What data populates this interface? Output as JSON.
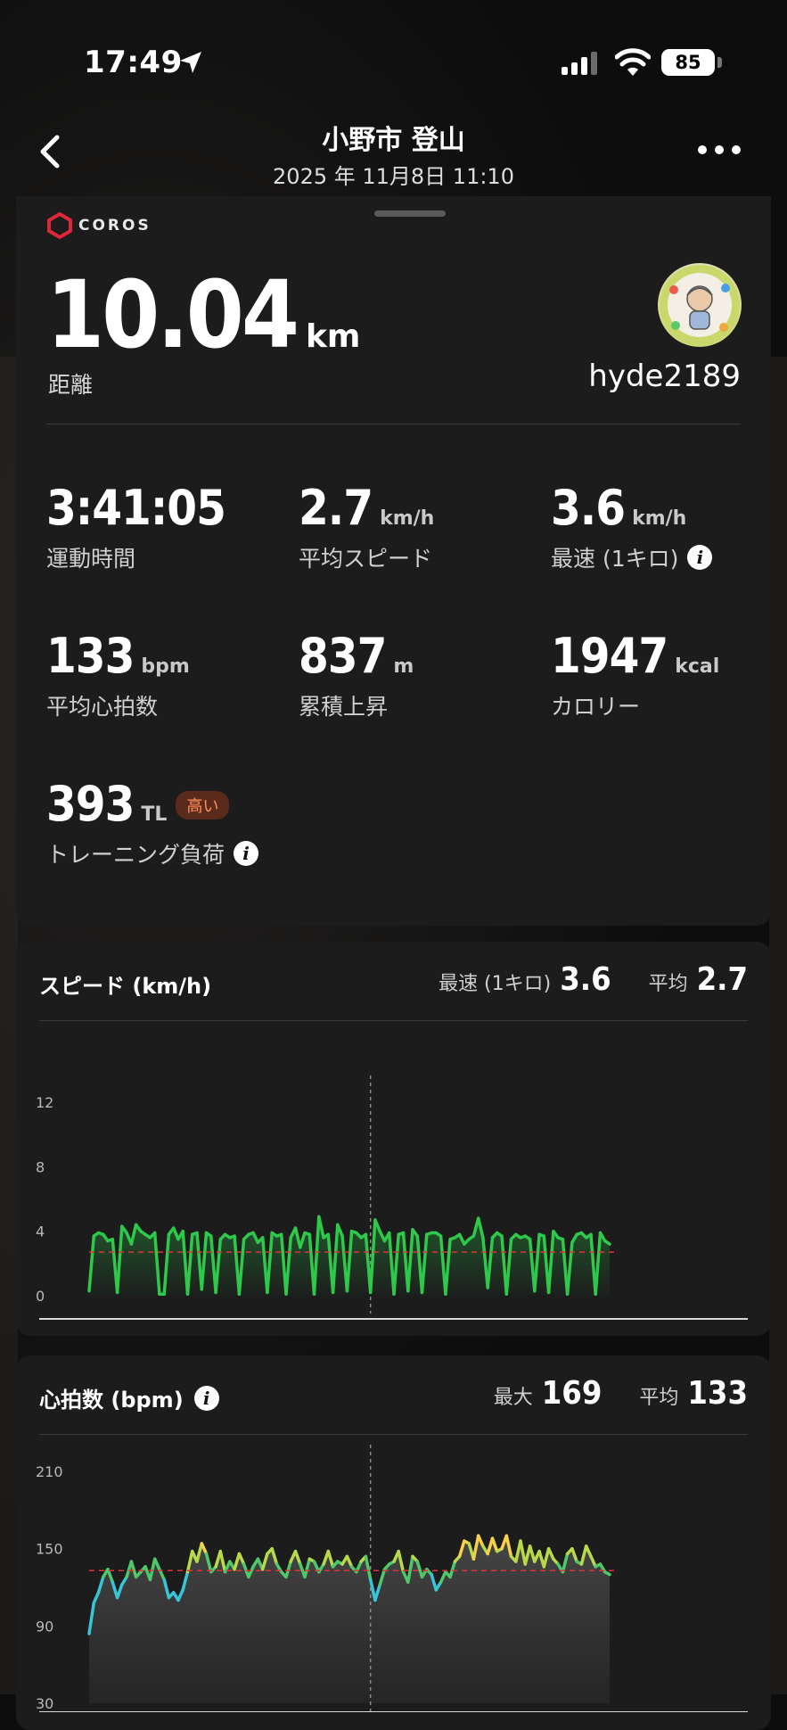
{
  "status_bar": {
    "time": "17:49",
    "battery": "85"
  },
  "header": {
    "title": "小野市 登山",
    "subtitle": "2025 年 11月8日 11:10"
  },
  "brand": "COROS",
  "summary": {
    "distance": {
      "value": "10.04",
      "unit": "km",
      "label": "距離"
    },
    "username": "hyde2189",
    "stats": [
      {
        "value": "3:41:05",
        "unit": "",
        "label": "運動時間",
        "info": false
      },
      {
        "value": "2.7",
        "unit": "km/h",
        "label": "平均スピード",
        "info": false
      },
      {
        "value": "3.6",
        "unit": "km/h",
        "label": "最速 (1キロ)",
        "info": true
      },
      {
        "value": "133",
        "unit": "bpm",
        "label": "平均心拍数",
        "info": false
      },
      {
        "value": "837",
        "unit": "m",
        "label": "累積上昇",
        "info": false
      },
      {
        "value": "1947",
        "unit": "kcal",
        "label": "カロリー",
        "info": false
      }
    ],
    "training_load": {
      "value": "393",
      "unit": "TL",
      "badge": "高い",
      "label": "トレーニング負荷"
    }
  },
  "speed_chart": {
    "title": "スピード (km/h)",
    "max_label": "最速 (1キロ)",
    "max_value": "3.6",
    "avg_label": "平均",
    "avg_value": "2.7"
  },
  "hr_chart": {
    "title": "心拍数 (bpm)",
    "max_label": "最大",
    "max_value": "169",
    "avg_label": "平均",
    "avg_value": "133"
  },
  "chart_data": [
    {
      "type": "line",
      "title": "スピード (km/h)",
      "xlabel": "",
      "ylabel": "",
      "x_ticks": [
        "0",
        "60",
        "120",
        "180",
        "222"
      ],
      "y_ticks": [
        "12",
        "8",
        "4",
        "0"
      ],
      "xlim": [
        0,
        222
      ],
      "ylim": [
        0,
        12
      ],
      "reference_line": 2.7,
      "color": "#2ec84a",
      "series": [
        {
          "x": [
            0,
            2,
            4,
            6,
            8,
            10,
            12,
            14,
            16,
            18,
            20,
            22,
            24,
            26,
            28,
            30,
            32,
            34,
            36,
            38,
            40,
            42,
            44,
            46,
            48,
            50,
            52,
            54,
            56,
            58,
            60,
            62,
            64,
            66,
            68,
            70,
            72,
            74,
            76,
            78,
            80,
            82,
            84,
            86,
            88,
            90,
            92,
            94,
            96,
            98,
            100,
            102,
            104,
            106,
            108,
            110,
            112,
            114,
            116,
            118,
            120,
            122,
            124,
            126,
            128,
            130,
            132,
            134,
            136,
            138,
            140,
            142,
            144,
            146,
            148,
            150,
            152,
            154,
            156,
            158,
            160,
            162,
            164,
            166,
            168,
            170,
            172,
            174,
            176,
            178,
            180,
            182,
            184,
            186,
            188,
            190,
            192,
            194,
            196,
            198,
            200,
            202,
            204,
            206,
            208,
            210,
            212,
            214,
            216,
            218,
            220,
            222
          ],
          "values": [
            0.3,
            3.7,
            3.9,
            3.8,
            3.4,
            3.5,
            0.2,
            4.3,
            3.9,
            3.2,
            4.4,
            4.0,
            3.8,
            3.6,
            3.9,
            0.1,
            0.1,
            3.8,
            4.2,
            3.5,
            4.0,
            0.1,
            3.8,
            3.9,
            0.4,
            3.9,
            3.7,
            0.2,
            3.5,
            3.8,
            3.6,
            3.7,
            0.1,
            3.5,
            3.8,
            3.9,
            3.3,
            3.6,
            0.2,
            3.9,
            3.7,
            3.8,
            0.1,
            3.6,
            4.2,
            3.0,
            3.9,
            3.8,
            0.1,
            4.9,
            3.6,
            3.8,
            0.2,
            4.4,
            3.7,
            0.3,
            4.0,
            3.9,
            3.6,
            3.8,
            0.2,
            4.7,
            4.0,
            3.4,
            3.9,
            0.1,
            3.8,
            3.9,
            0.3,
            4.1,
            3.7,
            0.2,
            3.8,
            3.9,
            3.9,
            3.7,
            0.1,
            3.5,
            3.6,
            3.8,
            3.2,
            3.5,
            3.7,
            4.8,
            3.6,
            0.5,
            3.6,
            3.9,
            3.7,
            0.1,
            3.5,
            3.8,
            3.6,
            3.7,
            3.5,
            0.3,
            3.8,
            3.7,
            0.2,
            4.0,
            3.6,
            3.5,
            0.1,
            3.3,
            3.8,
            3.9,
            3.6,
            3.8,
            0.1,
            3.9,
            3.4,
            3.2
          ]
        }
      ]
    },
    {
      "type": "line",
      "title": "心拍数 (bpm)",
      "xlabel": "",
      "ylabel": "",
      "y_ticks": [
        "210",
        "150",
        "90",
        "30"
      ],
      "xlim": [
        0,
        222
      ],
      "ylim": [
        30,
        210
      ],
      "reference_line": 133,
      "series": [
        {
          "x": [
            0,
            2,
            4,
            6,
            8,
            10,
            12,
            14,
            16,
            18,
            20,
            22,
            24,
            26,
            28,
            30,
            32,
            34,
            36,
            38,
            40,
            42,
            44,
            46,
            48,
            50,
            52,
            54,
            56,
            58,
            60,
            62,
            64,
            66,
            68,
            70,
            72,
            74,
            76,
            78,
            80,
            82,
            84,
            86,
            88,
            90,
            92,
            94,
            96,
            98,
            100,
            102,
            104,
            106,
            108,
            110,
            112,
            114,
            116,
            118,
            120,
            122,
            124,
            126,
            128,
            130,
            132,
            134,
            136,
            138,
            140,
            142,
            144,
            146,
            148,
            150,
            152,
            154,
            156,
            158,
            160,
            162,
            164,
            166,
            168,
            170,
            172,
            174,
            176,
            178,
            180,
            182,
            184,
            186,
            188,
            190,
            192,
            194,
            196,
            198,
            200,
            202,
            204,
            206,
            208,
            210,
            212,
            214,
            216,
            218,
            220,
            222
          ],
          "values": [
            84,
            108,
            116,
            128,
            134,
            124,
            112,
            122,
            128,
            140,
            128,
            132,
            136,
            126,
            142,
            134,
            126,
            112,
            116,
            110,
            118,
            132,
            148,
            140,
            154,
            146,
            132,
            136,
            148,
            132,
            140,
            134,
            146,
            138,
            128,
            136,
            142,
            134,
            146,
            150,
            138,
            132,
            128,
            140,
            148,
            138,
            128,
            142,
            140,
            132,
            138,
            148,
            136,
            140,
            138,
            144,
            136,
            132,
            140,
            144,
            126,
            110,
            122,
            134,
            138,
            140,
            148,
            132,
            124,
            144,
            140,
            128,
            134,
            130,
            118,
            124,
            132,
            128,
            140,
            144,
            156,
            154,
            142,
            160,
            152,
            146,
            158,
            148,
            150,
            160,
            144,
            140,
            156,
            138,
            152,
            140,
            148,
            136,
            150,
            142,
            138,
            132,
            146,
            150,
            140,
            138,
            152,
            144,
            136,
            138,
            132,
            130
          ]
        }
      ]
    }
  ]
}
